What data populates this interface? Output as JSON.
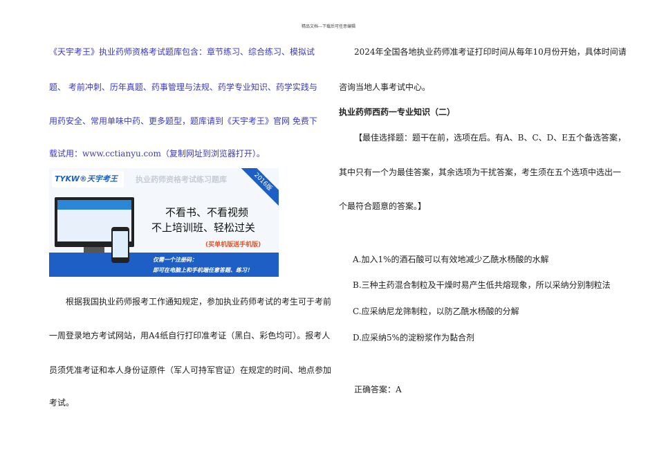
{
  "header": "精品文档---下载后可任意编辑",
  "left": {
    "promo_lines": [
      "《天宇考王》执业药师资格考试题库包含：章节练习、综合练习、模拟试",
      "题、 考前冲刺、历年真题、药事管理与法规、药学专业知识、药学实践与",
      "用药安全、常用单味中药、更多题型，题库请到《天宇考王》官网 免费下",
      "载试用：www.cctianyu.com（复制网址到浏览器打开）。"
    ],
    "banner": {
      "logo": "TYKW®天宇考王",
      "title": "执业药师资格考试练习题库",
      "ribbon": "2016版",
      "slogan1": "不看书、不看视频",
      "slogan2": "不上培训班、轻松过关",
      "promo": "(买单机版送手机版)",
      "bar1": "仅需一个注册码：",
      "bar2": "即可在电脑上和手机端任意答题、练习！"
    },
    "para_lines": [
      "根据我国执业药师报考工作通知规定，参加执业药师考试的考生可于考前",
      "一周登录地方考试网站，用A4纸自行打印准考证（黑白、彩色均可）。报考人",
      "员须凭准考证和本人身份证原件（军人可持军官证）在规定的时间、地点参加",
      "考试。"
    ]
  },
  "right": {
    "intro_lines": [
      "2024年全国各地执业药师准考证打印时间从每年10月份开始，具体时间请",
      "咨询当地人事考试中心。"
    ],
    "heading": "执业药师西药一专业知识（二）",
    "instr_lines": [
      "【最佳选择题：题干在前，选项在后。有A、B、C、D、E五个备选答案，",
      "其中只有一个为最佳答案，其余选项为干扰答案，考生须在五个选项中选出一",
      "个最符合题意的答案。】"
    ],
    "options": [
      "A.加入1%的酒石酸可以有效地减少乙酰水杨酸的水解",
      "B.三种主药混合制粒及干燥时易产生低共熔现象，所以采纳分别制粒法",
      "C.应采纳尼龙筛制粒，以防乙酰水杨酸的分解",
      "D.应采纳5%的淀粉浆作为黏合剂"
    ],
    "answer": "正确答案：A"
  }
}
